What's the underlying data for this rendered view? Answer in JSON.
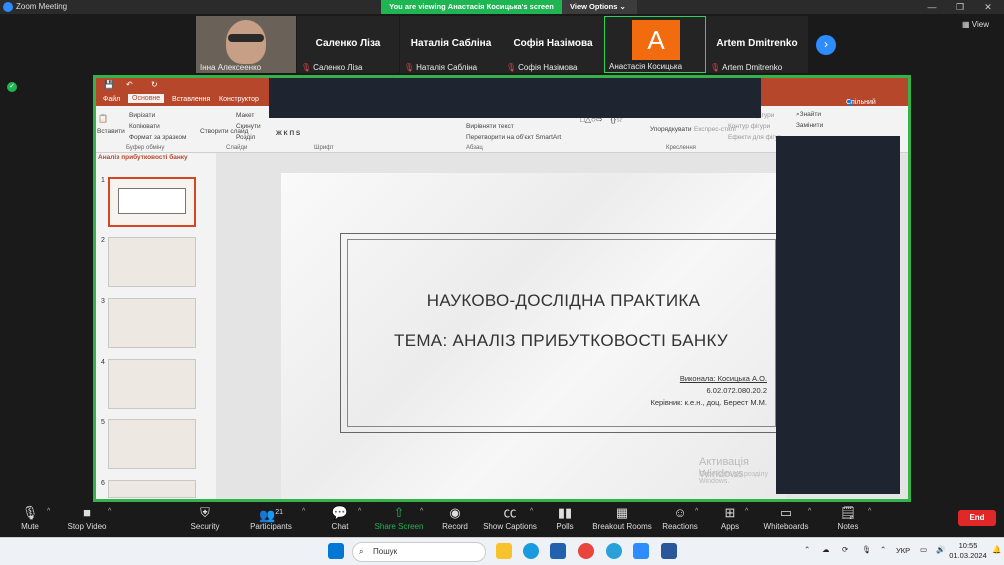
{
  "window": {
    "title": "Zoom Meeting"
  },
  "banner": {
    "message": "You are viewing Анастасія Косицька's screen",
    "view_options": "View Options"
  },
  "top_right": {
    "view": "View"
  },
  "participants": [
    {
      "name": "Інна Алексеенко",
      "muted": false,
      "video": true
    },
    {
      "name": "Саленко Ліза",
      "muted": true
    },
    {
      "name": "Наталія Сабліна",
      "muted": true
    },
    {
      "name": "Софія Назімова",
      "muted": true
    },
    {
      "name": "Анастасія Косицька",
      "muted": false,
      "avatar": "A",
      "avatar_color": "#f26b0f"
    },
    {
      "name": "Artem Dmitrenko",
      "muted": true
    }
  ],
  "ppt": {
    "tabs": [
      "Файл",
      "Основне",
      "Вставлення",
      "Конструктор"
    ],
    "share_btn": "Спільний доступ",
    "ribbon": {
      "paste": "Вставити",
      "cut": "Вирізати",
      "copy": "Копіювати",
      "format": "Формат за зразком",
      "clipboard": "Буфер обміну",
      "create": "Створити слайд",
      "layout": "Макет",
      "reset": "Скинути",
      "section": "Розділ",
      "slides": "Слайди",
      "font": "Шрифт",
      "paragraph": "Абзац",
      "align_text": "Вирівняти текст",
      "smartart": "Перетворити на об'єкт SmartArt",
      "arrange": "Упорядкувати",
      "express": "Експрес-стилі",
      "fill": "Заливка фігури",
      "outline": "Контур фігури",
      "effects": "Ефекти для фігур",
      "drawing": "Креслення",
      "find": "Знайти",
      "replace": "Замінити"
    },
    "panel_title": "Аналіз прибутковості банку",
    "thumbs": [
      "1",
      "2",
      "3",
      "4",
      "5",
      "6"
    ],
    "slide": {
      "title": "НАУКОВО-ДОСЛІДНА ПРАКТИКА",
      "subtitle": "ТЕМА: АНАЛІЗ ПРИБУТКОВОСТІ БАНКУ",
      "author": "Виконала: Косицька А.О.",
      "code": "6.02.072.080.20.2",
      "supervisor": "Керівник: к.е.н., доц. Берест М.М."
    },
    "activate": "Активація Windows",
    "activate2": "Перейдіть до розділу",
    "activate3": "Windows."
  },
  "toolbar": {
    "mute": "Mute",
    "stop_video": "Stop Video",
    "security": "Security",
    "participants": "Participants",
    "participants_count": "21",
    "chat": "Chat",
    "share": "Share Screen",
    "record": "Record",
    "captions": "Show Captions",
    "polls": "Polls",
    "breakout": "Breakout Rooms",
    "reactions": "Reactions",
    "apps": "Apps",
    "whiteboards": "Whiteboards",
    "notes": "Notes",
    "end": "End"
  },
  "taskbar": {
    "search": "Пошук",
    "lang": "УКР",
    "time": "10:55",
    "date": "01.03.2024"
  }
}
